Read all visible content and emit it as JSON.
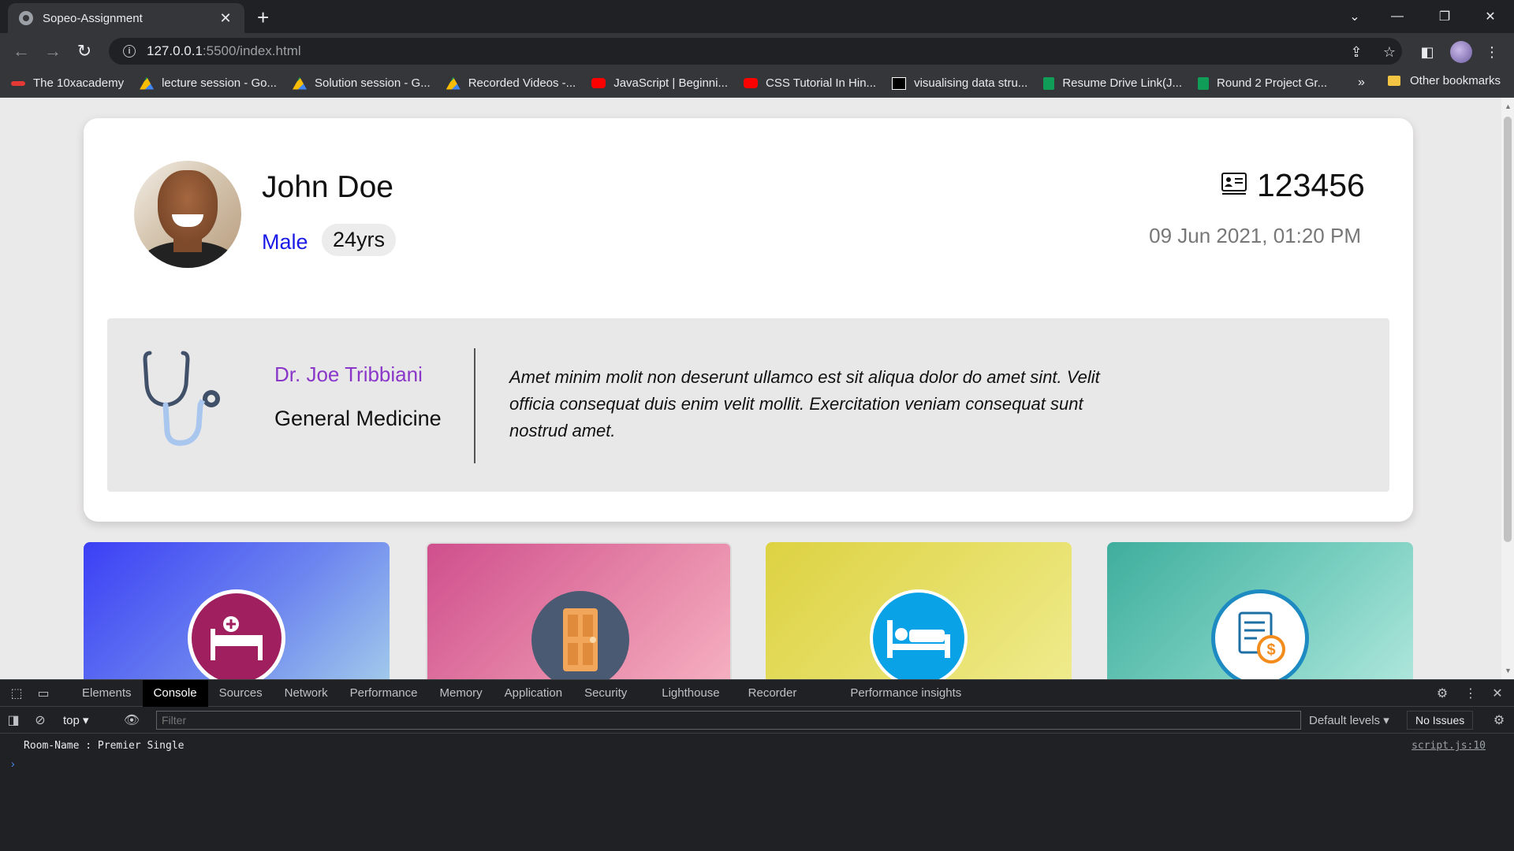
{
  "browser": {
    "tab_title": "Sopeo-Assignment",
    "tab_close": "✕",
    "new_tab": "+",
    "url_host": "127.0.0.1",
    "url_path": ":5500/index.html",
    "bookmarks": [
      {
        "label": "The 10xacademy",
        "icon": "academy-icon",
        "color": "#e53935"
      },
      {
        "label": "lecture session - Go...",
        "icon": "google-drive-icon",
        "color": "#fbbc04"
      },
      {
        "label": "Solution session - G...",
        "icon": "google-drive-icon",
        "color": "#fbbc04"
      },
      {
        "label": "Recorded Videos -...",
        "icon": "google-drive-icon",
        "color": "#fbbc04"
      },
      {
        "label": "JavaScript | Beginni...",
        "icon": "youtube-icon",
        "color": "#ff0000"
      },
      {
        "label": "CSS Tutorial In Hin...",
        "icon": "youtube-icon",
        "color": "#ff0000"
      },
      {
        "label": "visualising data stru...",
        "icon": "visualgo-icon",
        "color": "#ffffff"
      },
      {
        "label": "Resume Drive Link(J...",
        "icon": "google-sheets-icon",
        "color": "#0f9d58"
      },
      {
        "label": "Round 2 Project Gr...",
        "icon": "google-sheets-icon",
        "color": "#0f9d58"
      }
    ],
    "bookmarks_overflow": "»",
    "other_bookmarks": "Other bookmarks"
  },
  "page": {
    "patient": {
      "name": "John Doe",
      "gender": "Male",
      "age": "24yrs",
      "id": "123456",
      "datetime": "09 Jun 2021, 01:20 PM"
    },
    "doctor": {
      "name": "Dr. Joe Tribbiani",
      "specialty": "General Medicine",
      "note": "Amet minim molit non deserunt ullamco est sit aliqua dolor do amet sint. Velit officia consequat duis enim velit mollit. Exercitation veniam consequat sunt nostrud amet."
    },
    "tiles": [
      {
        "icon": "hospital-bed-icon"
      },
      {
        "icon": "door-icon"
      },
      {
        "icon": "bed-icon"
      },
      {
        "icon": "billing-icon"
      }
    ]
  },
  "devtools": {
    "tabs": [
      "Elements",
      "Console",
      "Sources",
      "Network",
      "Performance",
      "Memory",
      "Application",
      "Security",
      "Lighthouse",
      "Recorder",
      "Performance insights"
    ],
    "active_tab": "Console",
    "context": "top",
    "filter_placeholder": "Filter",
    "levels": "Default levels ▾",
    "issues": "No Issues",
    "log_message": "Room-Name : Premier Single",
    "log_source": "script.js:10",
    "prompt": "›"
  }
}
